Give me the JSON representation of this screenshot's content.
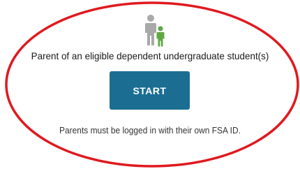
{
  "card": {
    "icon": "parent-child-icon",
    "title": "Parent of an eligible dependent undergraduate student(s)",
    "button_label": "START",
    "note": "Parents must be logged in with their own FSA ID."
  },
  "colors": {
    "button_bg": "#1b6e92",
    "annotation_ellipse": "#e0191f",
    "icon_parent": "#a9a9a9",
    "icon_child": "#5fa843"
  }
}
